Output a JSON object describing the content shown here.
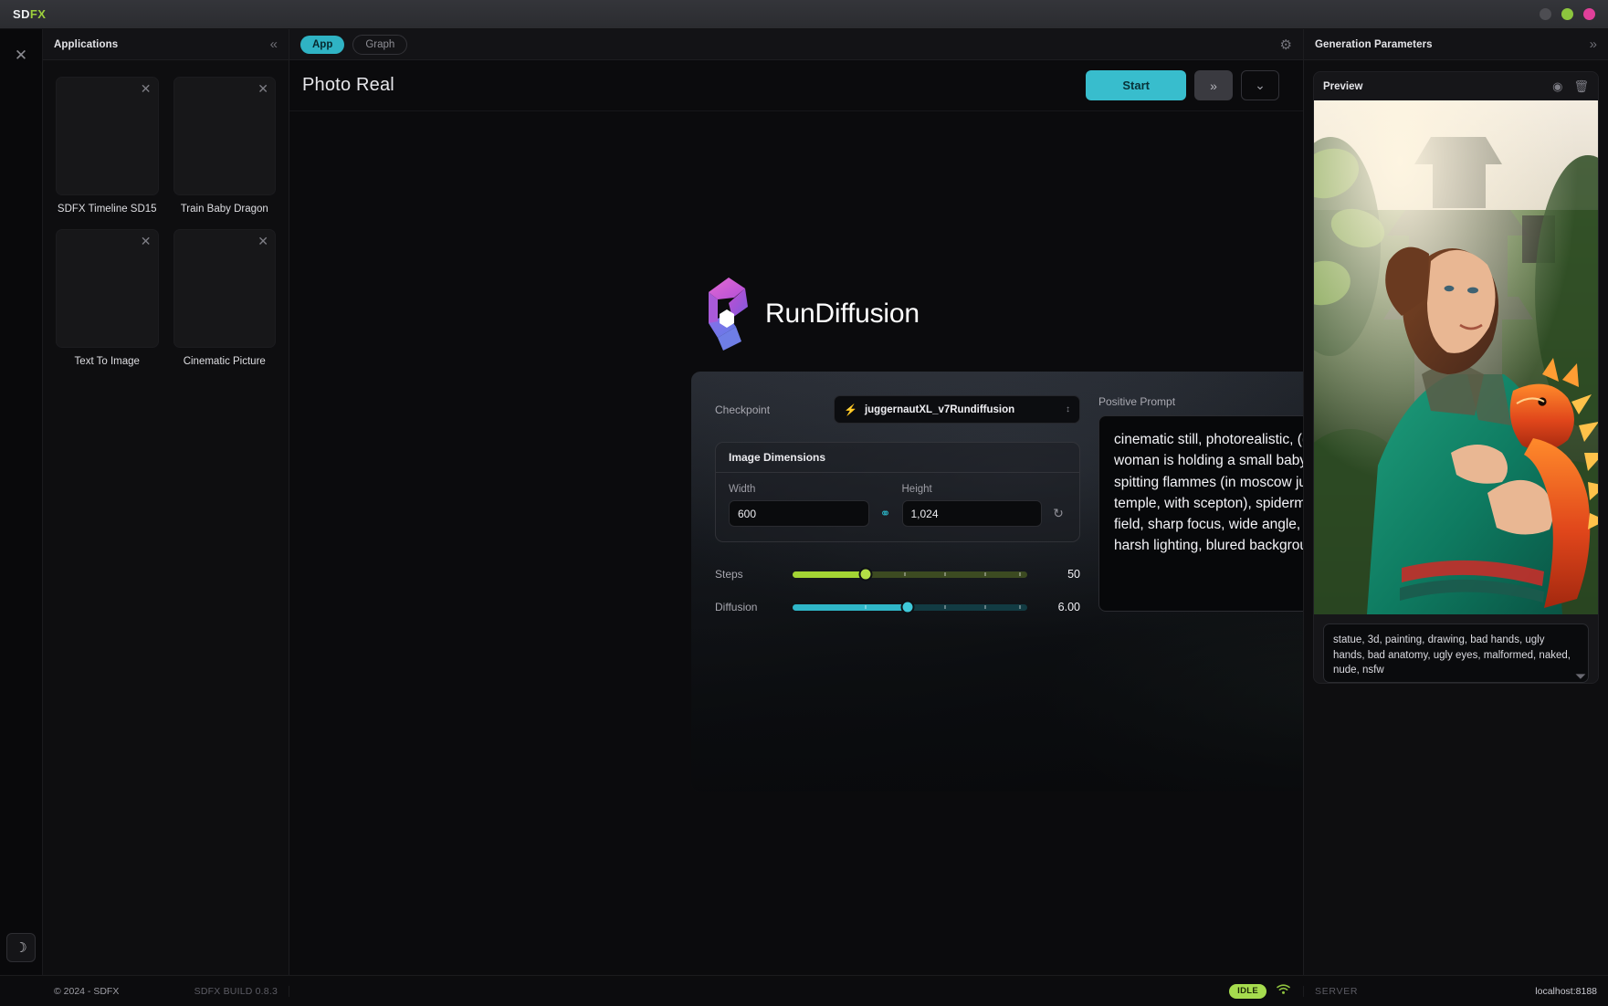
{
  "titlebar": {
    "brand_first": "SD",
    "brand_second": "FX",
    "window_dots": [
      {
        "name": "minimize",
        "color": "#4d4d52"
      },
      {
        "name": "maximize",
        "color": "#8cc63e"
      },
      {
        "name": "close",
        "color": "#e0409a"
      }
    ]
  },
  "rail": {
    "close_icon": "✕",
    "theme_icon": "☽"
  },
  "applications": {
    "title": "Applications",
    "collapse_icon": "«",
    "close_icon": "✕",
    "items": [
      {
        "label": "SDFX Timeline SD15"
      },
      {
        "label": "Train Baby Dragon"
      },
      {
        "label": "Text To Image"
      },
      {
        "label": "Cinematic Picture"
      }
    ],
    "footer": {
      "copyright": "© 2024 - SDFX",
      "build": "SDFX BUILD 0.8.3"
    }
  },
  "center": {
    "tabs": [
      {
        "label": "App",
        "active": true
      },
      {
        "label": "Graph",
        "active": false
      }
    ],
    "settings_icon": "⚙",
    "page_title": "Photo Real",
    "start_label": "Start",
    "queue_icon": "»",
    "caret_icon": "⌄",
    "logo_text": "RunDiffusion",
    "parameters": {
      "checkpoint_label": "Checkpoint",
      "checkpoint_bolt": "⚡",
      "checkpoint_value": "juggernautXL_v7Rundiffusion",
      "checkpoint_caret": "↕",
      "dimensions_title": "Image Dimensions",
      "width_label": "Width",
      "width_value": "600",
      "height_label": "Height",
      "height_value": "1,024",
      "link_icon": "⚭",
      "refresh_icon": "↻",
      "steps_label": "Steps",
      "steps_value": "50",
      "steps_pct": 31,
      "diffusion_label": "Diffusion",
      "diffusion_value": "6.00",
      "diffusion_pct": 49,
      "positive_prompt_label": "Positive Prompt",
      "positive_prompt": "cinematic still, photorealistic, ((a baby dragon)), (a woman is holding a small baby dragon in her arms), spitting flammes (in moscow jungle with ancien temple, with scepton), spiderman outfit - depth of field, sharp focus, wide angle, 4k , highly detailed, harsh lighting, blured background"
    }
  },
  "generation_parameters": {
    "title": "Generation Parameters",
    "collapse_icon": "»",
    "preview_title": "Preview",
    "focus_icon": "◉",
    "trash_icon": "🗑",
    "negative_prompt": "statue, 3d, painting, drawing, bad hands, ugly hands, bad anatomy, ugly eyes, malformed, naked, nude, nsfw"
  },
  "statusbar": {
    "status_badge": "IDLE",
    "wifi_icon": "◠",
    "server_label": "SERVER",
    "server_value": "localhost:8188"
  },
  "colors": {
    "accent_teal": "#38bdcd",
    "accent_green": "#a3d434",
    "idle_green": "#a6dc4e",
    "brand_green": "#9ccf3c"
  }
}
